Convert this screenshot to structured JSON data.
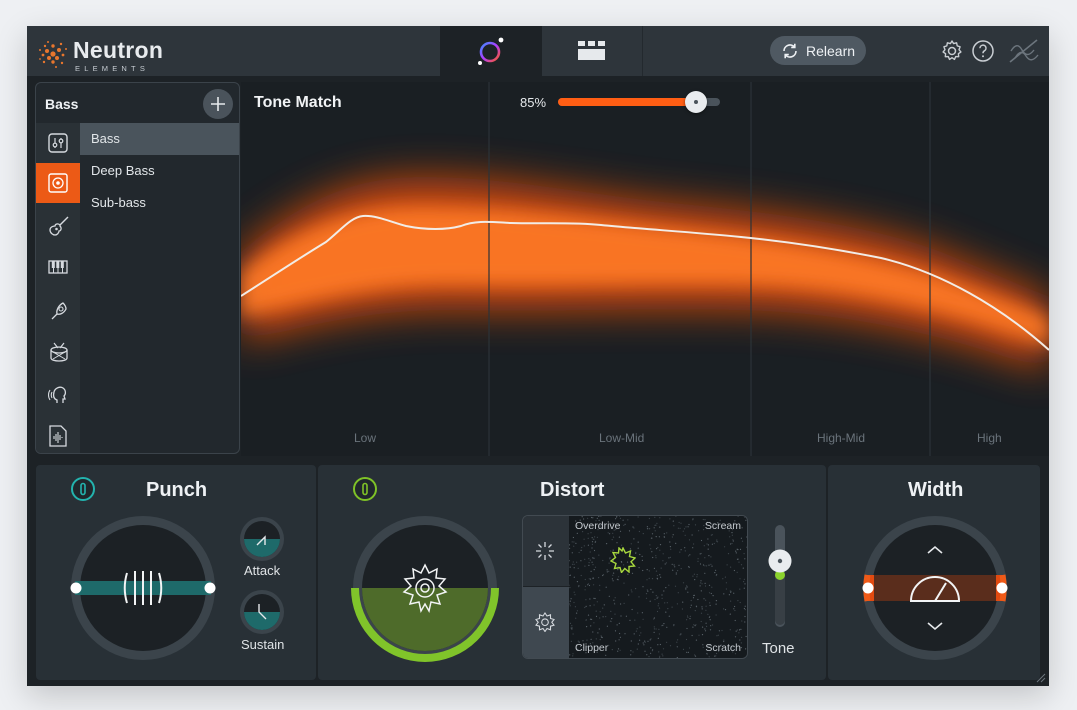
{
  "app": {
    "name": "Neutron",
    "sub": "ELEMENTS",
    "relearn_label": "Relearn"
  },
  "sidebar": {
    "title": "Bass",
    "selected_index": 1,
    "icons": [
      "mixer-icon",
      "bass-amp-icon",
      "guitar-icon",
      "piano-icon",
      "horn-icon",
      "drum-icon",
      "voice-icon",
      "audio-file-icon"
    ],
    "presets": [
      {
        "label": "Bass",
        "selected": true
      },
      {
        "label": "Deep Bass",
        "selected": false
      },
      {
        "label": "Sub-bass",
        "selected": false
      }
    ]
  },
  "tone_match": {
    "title": "Tone Match",
    "amount_label": "85%",
    "amount": 0.85,
    "bands": [
      "Low",
      "Low-Mid",
      "High-Mid",
      "High"
    ]
  },
  "punch": {
    "title": "Punch",
    "attack_label": "Attack",
    "sustain_label": "Sustain"
  },
  "distort": {
    "title": "Distort",
    "labels": {
      "top_left": "Overdrive",
      "top_right": "Scream",
      "bottom_left": "Clipper",
      "bottom_right": "Scratch"
    },
    "tone_label": "Tone"
  },
  "width": {
    "title": "Width"
  },
  "colors": {
    "accent": "#ec5a16",
    "punch": "#23b3ae",
    "distort": "#7fc227"
  }
}
